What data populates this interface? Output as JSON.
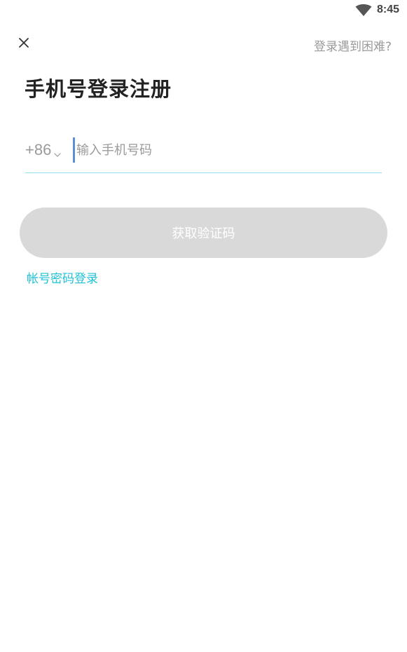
{
  "status_bar": {
    "time": "8:45",
    "wifi_icon": "wifi-icon"
  },
  "header": {
    "close_icon": "close-icon",
    "help_label": "登录遇到困难?"
  },
  "main": {
    "title": "手机号登录注册",
    "country_code": "+86",
    "phone_placeholder": "输入手机号码",
    "phone_value": "",
    "get_code_label": "获取验证码",
    "password_login_label": "帐号密码登录"
  },
  "colors": {
    "accent": "#1fc2d8",
    "button_disabled": "#d9d9d9",
    "underline": "#8fdcef"
  }
}
